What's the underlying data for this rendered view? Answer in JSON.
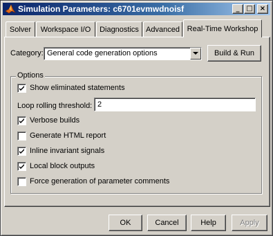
{
  "window": {
    "title": "Simulation Parameters: c6701evmwdnoisf",
    "minimize_glyph": "_",
    "maximize_glyph": "□",
    "close_glyph": "×"
  },
  "tabs": [
    {
      "label": "Solver",
      "active": false
    },
    {
      "label": "Workspace I/O",
      "active": false
    },
    {
      "label": "Diagnostics",
      "active": false
    },
    {
      "label": "Advanced",
      "active": false
    },
    {
      "label": "Real-Time Workshop",
      "active": true
    }
  ],
  "category": {
    "label": "Category:",
    "selected": "General code generation options"
  },
  "build_button": "Build & Run",
  "options": {
    "title": "Options",
    "show_eliminated": {
      "label": "Show eliminated statements",
      "checked": true
    },
    "loop_rolling": {
      "label": "Loop rolling threshold:",
      "value": "2"
    },
    "verbose_builds": {
      "label": "Verbose builds",
      "checked": true
    },
    "html_report": {
      "label": "Generate HTML report",
      "checked": false
    },
    "inline_invariant": {
      "label": "Inline invariant signals",
      "checked": true
    },
    "local_block": {
      "label": "Local block outputs",
      "checked": true
    },
    "force_param_comments": {
      "label": "Force generation of parameter comments",
      "checked": false
    }
  },
  "footer": {
    "ok": "OK",
    "cancel": "Cancel",
    "help": "Help",
    "apply": "Apply"
  },
  "colors": {
    "face": "#d4d0c8",
    "title_start": "#0a246a",
    "title_end": "#a6caf0"
  }
}
